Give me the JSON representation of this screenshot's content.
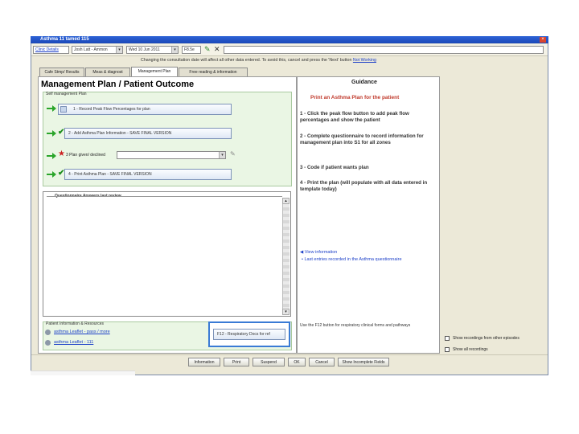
{
  "window": {
    "title": "Asthma 11 tamed 115"
  },
  "toolbar": {
    "clinic_button": "Clinic Details",
    "date_field": "Wed 10 Jun 2011",
    "clinician_field": "Josh Latt - Ammon",
    "code_field": "F8.5e"
  },
  "notice": {
    "text": "Changing the consultation date will affect all other data entered. To avoid this, cancel and press the 'Next' button",
    "link": "Not Working"
  },
  "tabs": [
    {
      "label": "Cafe Stmp/ Results"
    },
    {
      "label": "Meas & diagnost"
    },
    {
      "label": "Management Plan"
    },
    {
      "label": "Free reading & information"
    }
  ],
  "main": {
    "title": "Management Plan / Patient Outcome",
    "group_title": "Self management Plan",
    "steps": [
      {
        "label": "1 - Record Peak Flow Percentages for plan"
      },
      {
        "label": "2 - Add Asthma Plan Information - SAVE FINAL VERSION"
      },
      {
        "label": "4 - Print Asthma Plan - SAVE FINAL VERSION"
      }
    ],
    "plan_declined_label": "3 Plan given/ declined",
    "questionnaire_title": "Questionnaire Answers last review",
    "patient_info_title": "Patient Information & Resources",
    "patient_links": [
      "asthma Leaflet - pass / more",
      "asthma Leaflet - 111"
    ],
    "resp_button": "F12 - Respiratory Docs for ref"
  },
  "guidance": {
    "title": "Guidance",
    "subtitle": "Print an Asthma Plan for the patient",
    "items": [
      "1 - Click the peak flow button to add peak flow percentages and show the patient",
      "2 - Complete questionnaire to record information for management plan into S1 for all zones",
      "3 - Code if patient wants plan",
      "4 - Print the plan (will populate with all data entered in template today)"
    ],
    "view_info": "View information",
    "last_entries": "Last entries recorded in the Asthma questionnaire",
    "f12_note": "Use the F12 button for respiratory clinical forms and pathways"
  },
  "side": {
    "show_recordings": "Show recordings from other episodes",
    "show_all": "Show all recordings"
  },
  "bottom_buttons": [
    "Information",
    "Print",
    "Suspend",
    "OK",
    "Cancel",
    "Show Incomplete Fields"
  ],
  "colors": {
    "accent_green": "#2aa52a",
    "titlebar": "#2d63d6",
    "highlight_box": "#3a7bd5",
    "red_star": "#cc2222"
  }
}
